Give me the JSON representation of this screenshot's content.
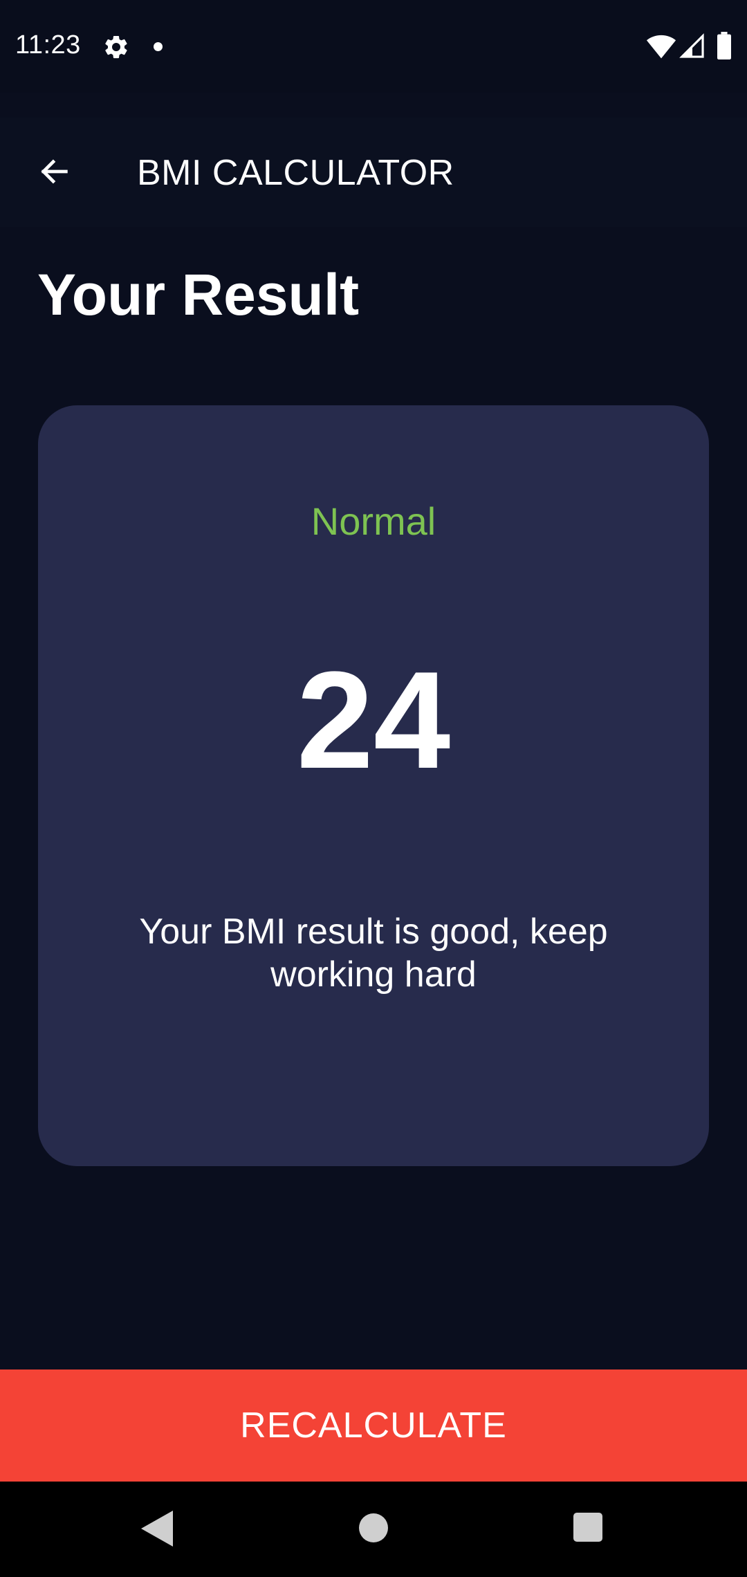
{
  "status_bar": {
    "time": "11:23",
    "icons": [
      "gear-icon",
      "notification-dot-icon",
      "wifi-icon",
      "signal-icon",
      "battery-icon"
    ]
  },
  "app_bar": {
    "back_icon": "arrow-left-icon",
    "title": "BMI CALCULATOR"
  },
  "page": {
    "title": "Your Result"
  },
  "result": {
    "category": "Normal",
    "value": "24",
    "message": "Your BMI result is good, keep working hard"
  },
  "actions": {
    "recalculate_label": "RECALCULATE"
  },
  "navigation": {
    "icons": [
      "nav-back-icon",
      "nav-home-icon",
      "nav-recents-icon"
    ]
  },
  "colors": {
    "background": "#0a0e1e",
    "card": "#272b4c",
    "category_green": "#7ec352",
    "button_red": "#f44336",
    "text": "#ffffff"
  }
}
